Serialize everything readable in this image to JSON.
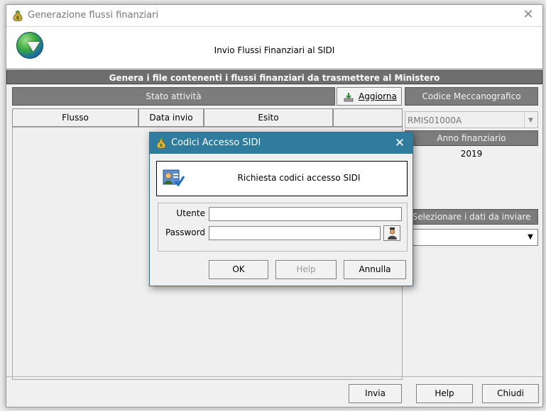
{
  "window": {
    "title": "Generazione flussi finanziari",
    "close_glyph": "✕"
  },
  "header": {
    "title": "Invio Flussi Finanziari al SIDI"
  },
  "banner": {
    "text": "Genera i file contenenti i flussi finanziari da trasmettere al Ministero"
  },
  "status": {
    "title": "Stato attività",
    "refresh_label": "Aggiorna"
  },
  "table": {
    "columns": [
      "Flusso",
      "Data invio",
      "Esito",
      ""
    ]
  },
  "right": {
    "meccanografico_label": "Codice Meccanografico",
    "meccanografico_value": "RMIS01000A",
    "anno_label": "Anno finanziario",
    "anno_value": "2019",
    "select_label": "Selezionare i dati da inviare",
    "select_value": ""
  },
  "footer": {
    "send_label": "Invia",
    "help_label": "Help",
    "close_label": "Chiudi"
  },
  "dialog": {
    "title": "Codici Accesso SIDI",
    "close_glyph": "✕",
    "header_text": "Richiesta codici accesso SIDI",
    "user_label": "Utente",
    "user_value": "",
    "password_label": "Password",
    "password_value": "",
    "ok_label": "OK",
    "help_label": "Help",
    "cancel_label": "Annulla"
  },
  "icons": [
    "money-bag-icon",
    "globe-download-icon",
    "refresh-icon",
    "dropdown-arrow-icon",
    "key-user-icon",
    "user-lookup-icon",
    "close-icon"
  ]
}
